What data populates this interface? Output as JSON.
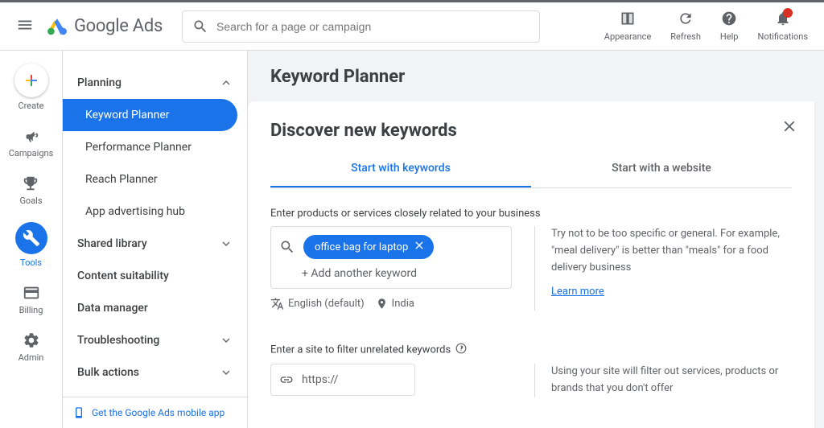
{
  "header": {
    "brand": "Google Ads",
    "search_placeholder": "Search for a page or campaign",
    "actions": {
      "appearance": "Appearance",
      "refresh": "Refresh",
      "help": "Help",
      "notifications": "Notifications"
    }
  },
  "rail": {
    "create": "Create",
    "campaigns": "Campaigns",
    "goals": "Goals",
    "tools": "Tools",
    "billing": "Billing",
    "admin": "Admin"
  },
  "sidebar": {
    "sections": {
      "planning": "Planning",
      "shared_library": "Shared library",
      "content_suitability": "Content suitability",
      "data_manager": "Data manager",
      "troubleshooting": "Troubleshooting",
      "bulk_actions": "Bulk actions"
    },
    "planning_items": {
      "keyword_planner": "Keyword Planner",
      "performance_planner": "Performance Planner",
      "reach_planner": "Reach Planner",
      "app_advertising_hub": "App advertising hub"
    },
    "app_promo": "Get the Google Ads mobile app"
  },
  "page": {
    "title": "Keyword Planner"
  },
  "card": {
    "title": "Discover new keywords",
    "tabs": {
      "keywords": "Start with keywords",
      "website": "Start with a website"
    },
    "products_label": "Enter products or services closely related to your business",
    "chip_value": "office bag for laptop",
    "add_another": "+ Add another keyword",
    "tip": "Try not to be too specific or general. For example, \"meal delivery\" is better than \"meals\" for a food delivery business",
    "learn_more": "Learn more",
    "language": "English (default)",
    "location": "India",
    "filter_label": "Enter a site to filter unrelated keywords",
    "url_prefix": "https://",
    "filter_tip": "Using your site will filter out services, products or brands that you don't offer"
  }
}
